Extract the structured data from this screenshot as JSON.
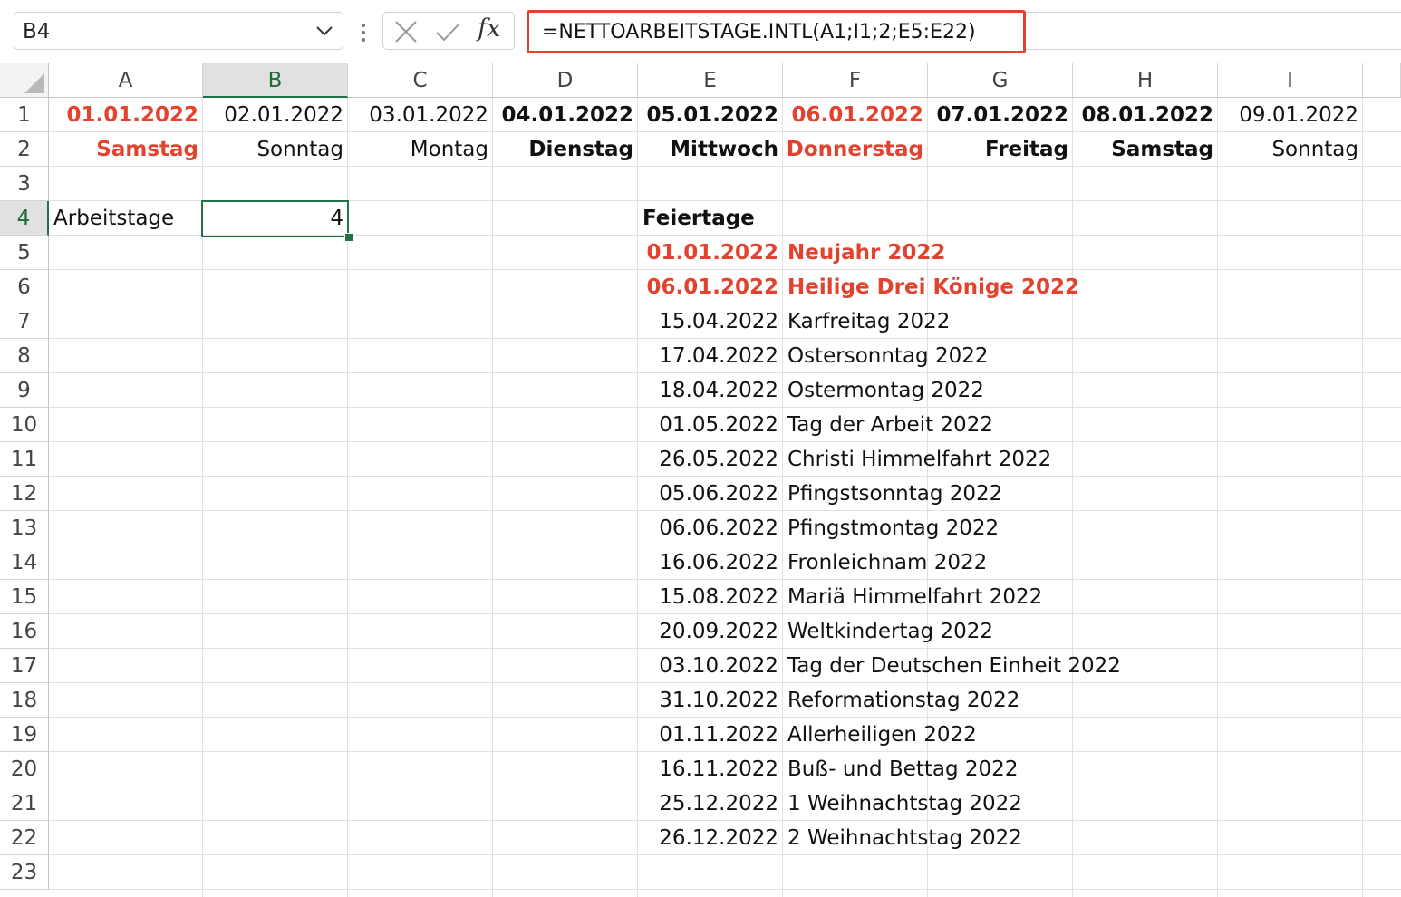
{
  "formula_bar": {
    "name_box": "B4",
    "fx_label": "fx",
    "formula": "=NETTOARBEITSTAGE.INTL(A1;I1;2;E5:E22)",
    "highlight_color": "#e1432f"
  },
  "columns": [
    "A",
    "B",
    "C",
    "D",
    "E",
    "F",
    "G",
    "H",
    "I"
  ],
  "rows": [
    "1",
    "2",
    "3",
    "4",
    "5",
    "6",
    "7",
    "8",
    "9",
    "10",
    "11",
    "12",
    "13",
    "14",
    "15",
    "16",
    "17",
    "18",
    "19",
    "20",
    "21",
    "22",
    "23"
  ],
  "row1": [
    "01.01.2022",
    "02.01.2022",
    "03.01.2022",
    "04.01.2022",
    "05.01.2022",
    "06.01.2022",
    "07.01.2022",
    "08.01.2022",
    "09.01.2022"
  ],
  "row2": [
    "Samstag",
    "Sonntag",
    "Montag",
    "Dienstag",
    "Mittwoch",
    "Donnerstag",
    "Freitag",
    "Samstag",
    "Sonntag"
  ],
  "a4": "Arbeitstage",
  "b4": "4",
  "e4": "Feiertage",
  "holidays": [
    {
      "date": "01.01.2022",
      "name": "Neujahr 2022"
    },
    {
      "date": "06.01.2022",
      "name": "Heilige Drei Könige 2022"
    },
    {
      "date": "15.04.2022",
      "name": "Karfreitag 2022"
    },
    {
      "date": "17.04.2022",
      "name": "Ostersonntag 2022"
    },
    {
      "date": "18.04.2022",
      "name": "Ostermontag 2022"
    },
    {
      "date": "01.05.2022",
      "name": "Tag der Arbeit 2022"
    },
    {
      "date": "26.05.2022",
      "name": "Christi Himmelfahrt 2022"
    },
    {
      "date": "05.06.2022",
      "name": "Pfingstsonntag 2022"
    },
    {
      "date": "06.06.2022",
      "name": "Pfingstmontag 2022"
    },
    {
      "date": "16.06.2022",
      "name": "Fronleichnam 2022"
    },
    {
      "date": "15.08.2022",
      "name": "Mariä Himmelfahrt 2022"
    },
    {
      "date": "20.09.2022",
      "name": "Weltkindertag 2022"
    },
    {
      "date": "03.10.2022",
      "name": "Tag der Deutschen Einheit 2022"
    },
    {
      "date": "31.10.2022",
      "name": "Reformationstag 2022"
    },
    {
      "date": "01.11.2022",
      "name": "Allerheiligen 2022"
    },
    {
      "date": "16.11.2022",
      "name": "Buß- und Bettag 2022"
    },
    {
      "date": "25.12.2022",
      "name": "1 Weihnachtstag 2022"
    },
    {
      "date": "26.12.2022",
      "name": "2 Weihnachtstag 2022"
    }
  ]
}
